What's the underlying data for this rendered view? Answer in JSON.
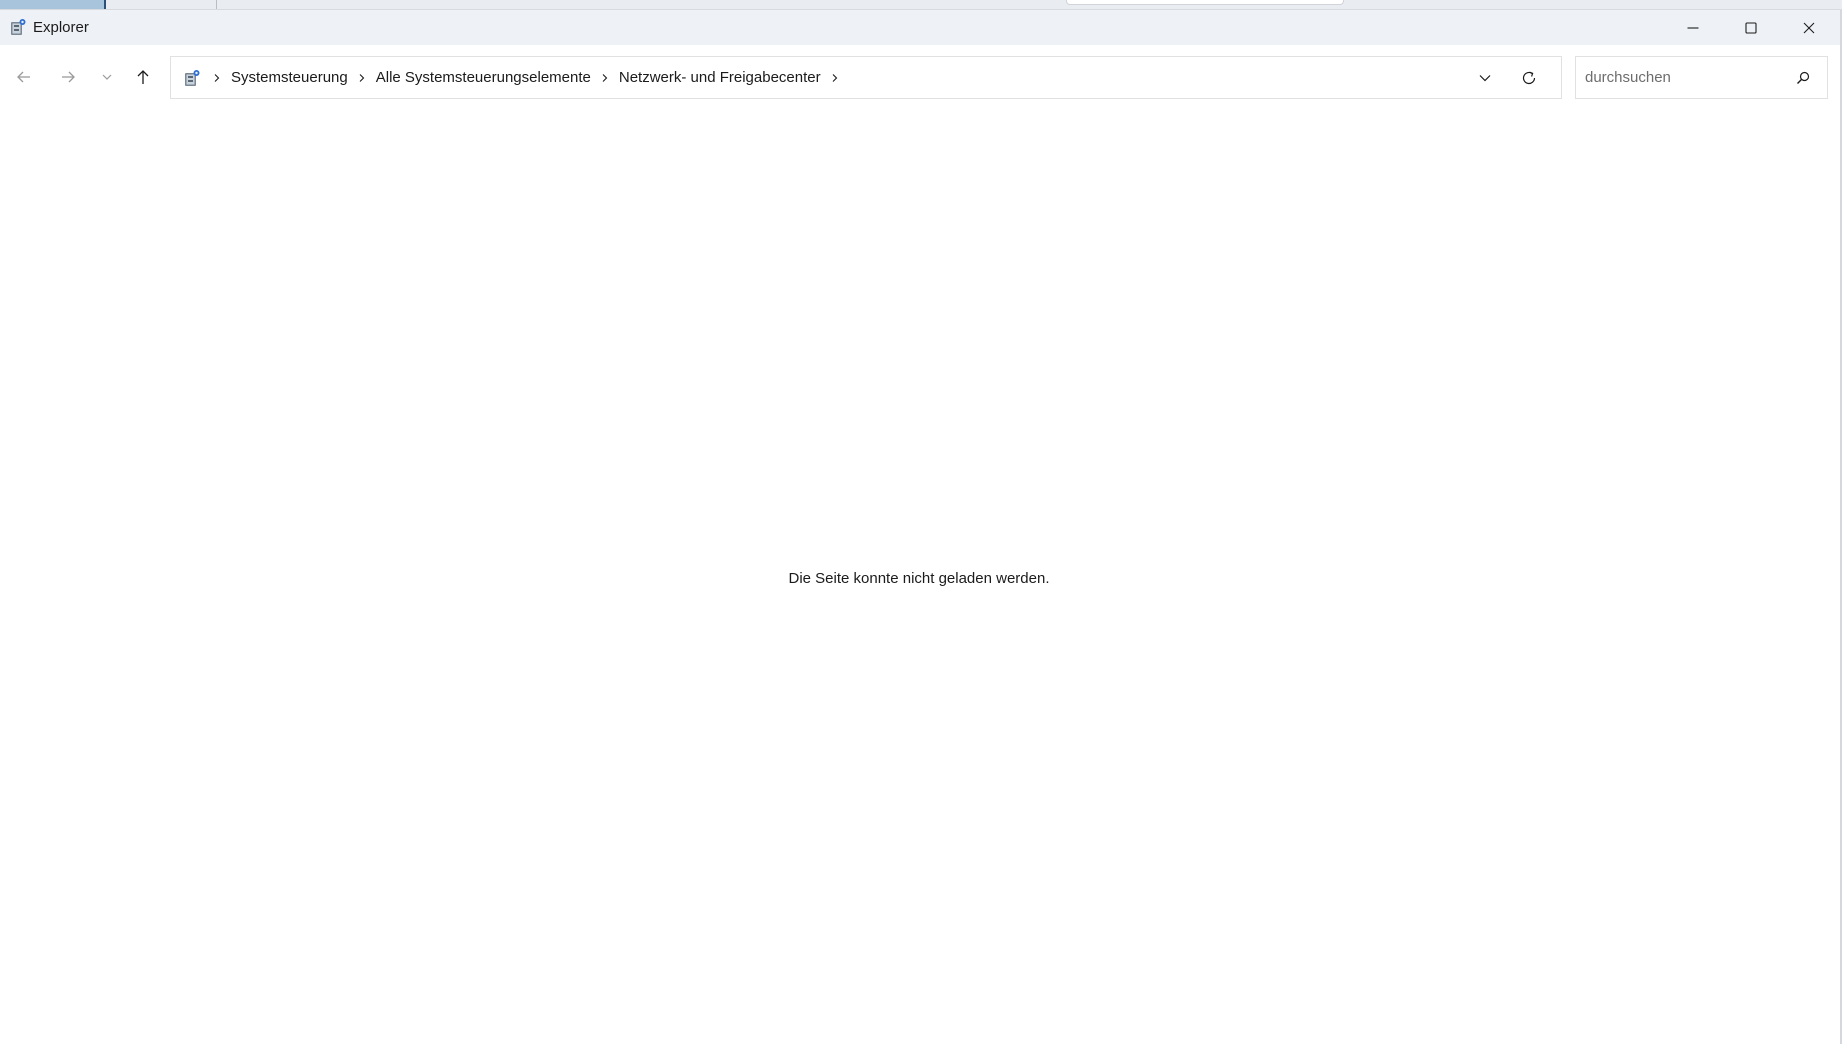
{
  "window": {
    "title": "Explorer",
    "app_icon": "control-panel-icon"
  },
  "title_bar": {
    "minimize_icon": "minimize-icon",
    "maximize_icon": "maximize-icon",
    "close_icon": "close-icon"
  },
  "navigation": {
    "back_icon": "arrow-left-icon",
    "forward_icon": "arrow-right-icon",
    "recent_icon": "chevron-down-icon",
    "up_icon": "arrow-up-icon"
  },
  "address_bar": {
    "root_icon": "control-panel-icon",
    "breadcrumbs": [
      "Systemsteuerung",
      "Alle Systemsteuerungselemente",
      "Netzwerk- und Freigabecenter"
    ],
    "separator_icon": "chevron-right-icon",
    "dropdown_icon": "chevron-down-icon",
    "refresh_icon": "refresh-icon"
  },
  "search": {
    "placeholder": "durchsuchen",
    "value": "",
    "icon": "search-icon"
  },
  "content": {
    "message": "Die Seite konnte nicht geladen werden."
  },
  "colors": {
    "title_bar_bg": "#eef2f6",
    "content_bg": "#ffffff",
    "border": "#e1e1e1",
    "text": "#1b1b1b",
    "placeholder": "#6d6d6d",
    "disabled_icon": "#9a9a9a"
  }
}
